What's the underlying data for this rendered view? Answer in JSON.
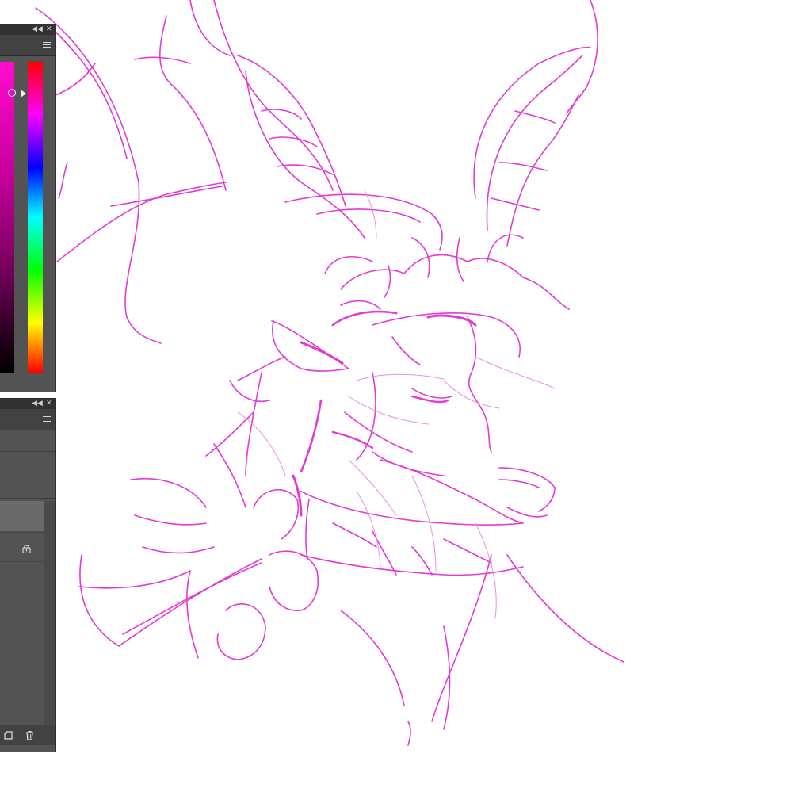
{
  "canvas": {
    "stroke_color": "#e23ad4",
    "stroke_color_light": "#ef8be6",
    "background": "#ffffff"
  },
  "color_panel": {
    "collapse_icon": "double-chevron-left-icon",
    "close_icon": "close-icon",
    "menu_icon": "panel-menu-icon",
    "current_color": "#ff00cc",
    "hue_top": "#ff0000"
  },
  "layers_panel": {
    "collapse_icon": "double-chevron-left-icon",
    "close_icon": "close-icon",
    "menu_icon": "panel-menu-icon",
    "layers": [
      {
        "selected": true,
        "locked": false
      },
      {
        "selected": false,
        "locked": true,
        "lock_icon": "lock-icon"
      }
    ],
    "footer": {
      "new_layer_icon": "new-layer-icon",
      "delete_layer_icon": "trash-icon"
    }
  }
}
